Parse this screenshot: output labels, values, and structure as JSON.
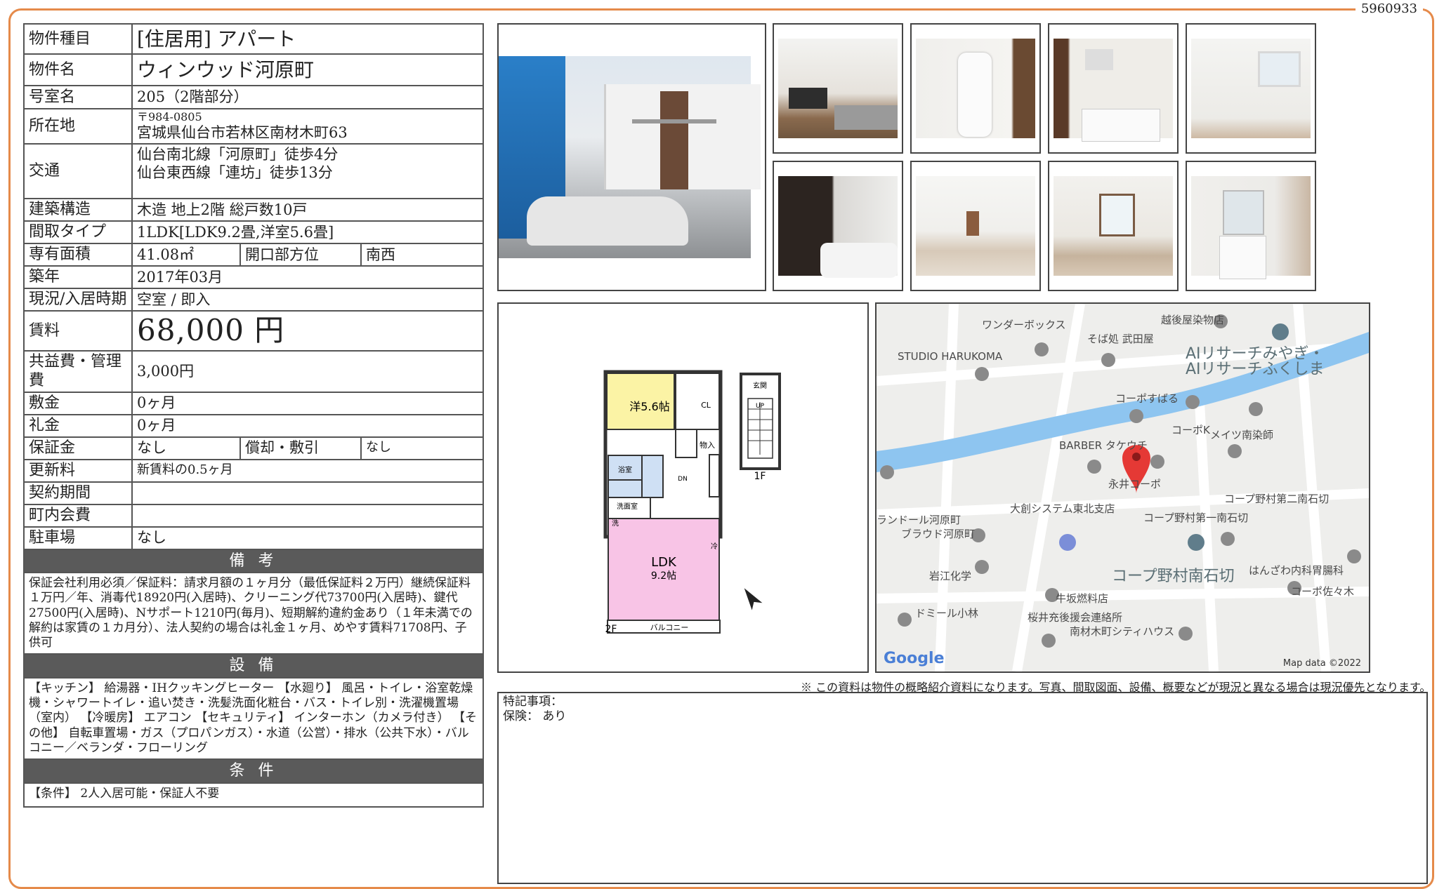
{
  "doc_id": "5960933",
  "spec": {
    "type_label": "物件種目",
    "type_value": "[住居用] アパート",
    "name_label": "物件名",
    "name_value": "ウィンウッド河原町",
    "room_label": "号室名",
    "room_value": "205（2階部分）",
    "address_label": "所在地",
    "postal": "〒984-0805",
    "address": "宮城県仙台市若林区南材木町63",
    "access_label": "交通",
    "access_1": "仙台南北線「河原町」徒歩4分",
    "access_2": "仙台東西線「連坊」徒歩13分",
    "structure_label": "建築構造",
    "structure_value": "木造 地上2階 総戸数10戸",
    "layout_label": "間取タイプ",
    "layout_value": "1LDK[LDK9.2畳,洋室5.6畳]",
    "area_label": "専有面積",
    "area_value": "41.08㎡",
    "direction_label": "開口部方位",
    "direction_value": "南西",
    "built_label": "築年",
    "built_value": "2017年03月",
    "status_label": "現況/入居時期",
    "status_value": "空室 / 即入",
    "rent_label": "賃料",
    "rent_value": "68,000 円",
    "fee_label": "共益費・管理費",
    "fee_value": "3,000円",
    "deposit_label": "敷金",
    "deposit_value": "0ヶ月",
    "keymoney_label": "礼金",
    "keymoney_value": "0ヶ月",
    "guarantee_label": "保証金",
    "guarantee_value": "なし",
    "amort_label": "償却・敷引",
    "amort_value": "なし",
    "renewal_label": "更新料",
    "renewal_value": "新賃料の0.5ヶ月",
    "term_label": "契約期間",
    "term_value": "",
    "town_label": "町内会費",
    "town_value": "",
    "parking_label": "駐車場",
    "parking_value": "なし"
  },
  "sections": {
    "notes_header": "備 考",
    "notes_text": "保証会社利用必須／保証料：請求月額の１ヶ月分（最低保証料２万円）継続保証料１万円／年、消毒代18920円(入居時)、クリーニング代73700円(入居時)、鍵代27500円(入居時)、Nサポート1210円(毎月)、短期解約違約金あり（１年未満での解約は家賃の１カ月分）、法人契約の場合は礼金１ヶ月、めやす賃料71708円、子供可",
    "equip_header": "設 備",
    "equip_text": "【キッチン】 給湯器・IHクッキングヒーター 【水廻り】 風呂・トイレ・浴室乾燥機・シャワートイレ・追い焚き・洗髪洗面化粧台・バス・トイレ別・洗濯機置場（室内） 【冷暖房】 エアコン 【セキュリティ】 インターホン（カメラ付き） 【その他】 自転車置場・ガス（プロパンガス）・水道（公営）・排水（公共下水）・バルコニー／ベランダ・フローリング",
    "cond_header": "条 件",
    "cond_text": "【条件】 2人入居可能・保証人不要"
  },
  "floorplan": {
    "room_western": "洋5.6帖",
    "cl": "CL",
    "storage": "物入",
    "bath": "浴室",
    "washroom": "洗面室",
    "wash": "洗",
    "ldk": "LDK",
    "ldk_size": "9.2帖",
    "fridge": "冷",
    "dn": "DN",
    "balcony": "バルコニー",
    "floor2": "2F",
    "floor1": "1F",
    "entrance": "玄関",
    "up": "UP"
  },
  "map": {
    "labels": [
      "ワンダーボックス",
      "越後屋染物店",
      "そば処 武田屋",
      "STUDIO HARUKOMA",
      "AIリサーチみやぎ・",
      "AIリサーチふくしま",
      "コーポすばる",
      "コーポK",
      "メイツ南染師",
      "BARBER タケウチ",
      "コープ野村第二南石切",
      "永井コーポ",
      "大創システム東北支店",
      "コープ野村第一南石切",
      "ランドール河原町",
      "ブラウド河原町",
      "岩江化学",
      "コープ野村南石切",
      "はんざわ内科胃腸科",
      "牛坂燃料店",
      "コーポ佐々木",
      "ドミール小林",
      "桜井充後援会連絡所",
      "南材木町シティハウス"
    ],
    "google": "Google",
    "credit": "Map data ©2022"
  },
  "disclaimer": "※ この資料は物件の概略紹介資料になります。写真、間取図面、設備、概要などが現況と異なる場合は現況優先となります。",
  "remarks": {
    "title": "特記事項：",
    "insurance": "保険： あり"
  }
}
